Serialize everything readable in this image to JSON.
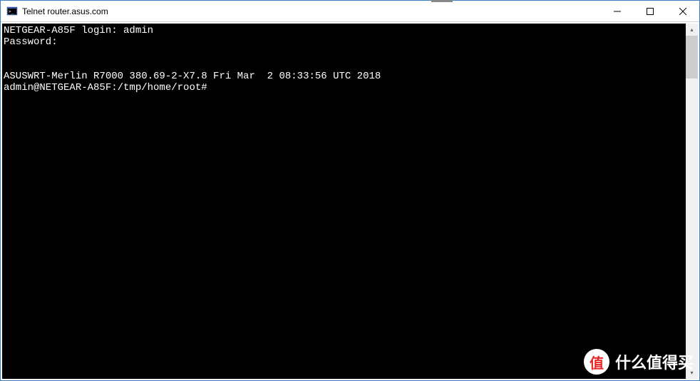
{
  "window": {
    "title": "Telnet router.asus.com"
  },
  "terminal": {
    "lines": {
      "line1": "NETGEAR-A85F login: admin",
      "line2": "Password:",
      "line3": "",
      "line4": "",
      "line5": "ASUSWRT-Merlin R7000 380.69-2-X7.8 Fri Mar  2 08:33:56 UTC 2018",
      "line6": "admin@NETGEAR-A85F:/tmp/home/root#"
    }
  },
  "watermark": {
    "badge": "值",
    "text": "什么值得买"
  }
}
